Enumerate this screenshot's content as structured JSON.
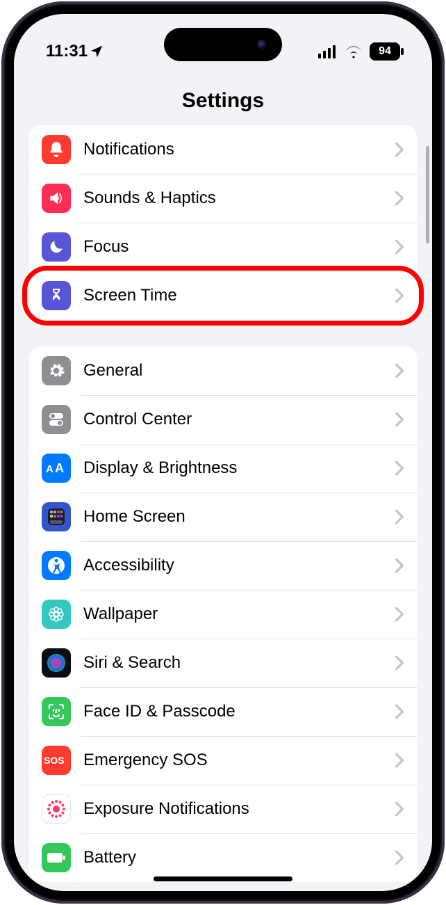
{
  "status": {
    "time": "11:31",
    "battery": "94"
  },
  "header": {
    "title": "Settings"
  },
  "groups": [
    {
      "rows": [
        {
          "name": "notifications",
          "label": "Notifications",
          "icon": "bell-icon",
          "bg": "#ff3b30"
        },
        {
          "name": "sounds-haptics",
          "label": "Sounds & Haptics",
          "icon": "speaker-icon",
          "bg": "#ff2d55"
        },
        {
          "name": "focus",
          "label": "Focus",
          "icon": "moon-icon",
          "bg": "#5856d6"
        },
        {
          "name": "screen-time",
          "label": "Screen Time",
          "icon": "hourglass-icon",
          "bg": "#5856d6",
          "highlighted": true
        }
      ]
    },
    {
      "rows": [
        {
          "name": "general",
          "label": "General",
          "icon": "gear-icon",
          "bg": "#8e8e93"
        },
        {
          "name": "control-center",
          "label": "Control Center",
          "icon": "switches-icon",
          "bg": "#8e8e93"
        },
        {
          "name": "display-brightness",
          "label": "Display & Brightness",
          "icon": "aa-icon",
          "bg": "#007aff"
        },
        {
          "name": "home-screen",
          "label": "Home Screen",
          "icon": "grid-icon",
          "bg": "#3355cc"
        },
        {
          "name": "accessibility",
          "label": "Accessibility",
          "icon": "accessibility-icon",
          "bg": "#007aff"
        },
        {
          "name": "wallpaper",
          "label": "Wallpaper",
          "icon": "flower-icon",
          "bg": "#34c7c0"
        },
        {
          "name": "siri-search",
          "label": "Siri & Search",
          "icon": "siri-icon",
          "bg": "#101020"
        },
        {
          "name": "face-id-passcode",
          "label": "Face ID & Passcode",
          "icon": "faceid-icon",
          "bg": "#34c759"
        },
        {
          "name": "emergency-sos",
          "label": "Emergency SOS",
          "icon": "sos-icon",
          "bg": "#ff3b30"
        },
        {
          "name": "exposure-notifications",
          "label": "Exposure Notifications",
          "icon": "exposure-icon",
          "bg": "#ffffff"
        },
        {
          "name": "battery",
          "label": "Battery",
          "icon": "battery-icon",
          "bg": "#34c759"
        }
      ]
    }
  ]
}
